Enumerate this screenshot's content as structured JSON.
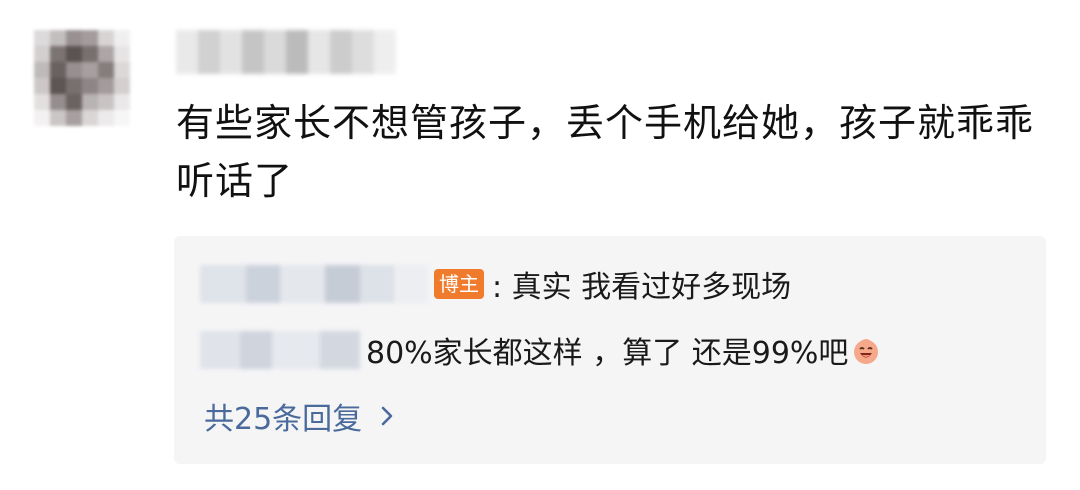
{
  "comment": {
    "text": "有些家长不想管孩子，丢个手机给她，孩子就乖乖听话了"
  },
  "replies": [
    {
      "badge": "博主",
      "text": ": 真实 我看过好多现场",
      "has_badge": true
    },
    {
      "prefix_fragment": "：",
      "text": "80%家长都这样 ，算了 还是99%吧",
      "emoji_icon": "laughing-face-icon"
    }
  ],
  "more_replies_label": "共25条回复",
  "colors": {
    "badge_bg": "#f07b2d",
    "link": "#4a6a9c",
    "reply_bg": "#f5f5f6"
  }
}
